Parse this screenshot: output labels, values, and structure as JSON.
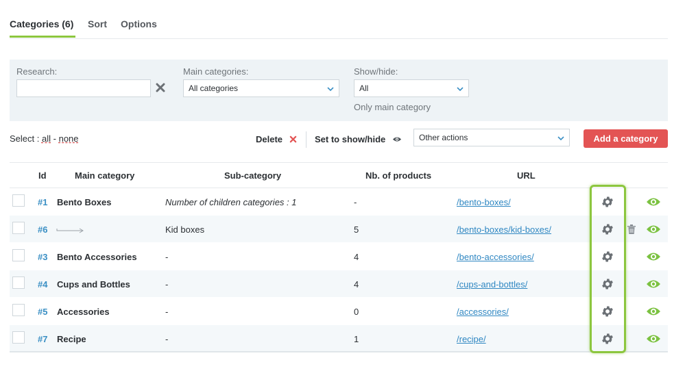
{
  "tabs": [
    {
      "label": "Categories (6)",
      "active": true
    },
    {
      "label": "Sort"
    },
    {
      "label": "Options"
    }
  ],
  "filters": {
    "research_label": "Research:",
    "research_value": "",
    "main_categories_label": "Main categories:",
    "main_categories_value": "All categories",
    "showhide_label": "Show/hide:",
    "showhide_value": "All",
    "only_main_label": "Only main category"
  },
  "toolbar": {
    "select_label": "Select :",
    "select_all": "all",
    "select_sep": "-",
    "select_none": "none",
    "delete_label": "Delete",
    "showhide_label": "Set to show/hide",
    "other_actions": "Other actions",
    "add_label": "Add a category"
  },
  "table": {
    "headers": {
      "id": "Id",
      "main": "Main category",
      "sub": "Sub-category",
      "nb": "Nb. of products",
      "url": "URL"
    },
    "rows": [
      {
        "id": "#1",
        "main": "Bento Boxes",
        "sub": "Number of children categories : 1",
        "nb": "-",
        "url": "/bento-boxes/"
      },
      {
        "id": "#6",
        "main": "",
        "sub": "Kid boxes",
        "nb": "5",
        "url": "/bento-boxes/kid-boxes/"
      },
      {
        "id": "#3",
        "main": "Bento Accessories",
        "sub": "-",
        "nb": "4",
        "url": "/bento-accessories/"
      },
      {
        "id": "#4",
        "main": "Cups and Bottles",
        "sub": "-",
        "nb": "4",
        "url": "/cups-and-bottles/"
      },
      {
        "id": "#5",
        "main": "Accessories",
        "sub": "-",
        "nb": "0",
        "url": "/accessories/"
      },
      {
        "id": "#7",
        "main": "Recipe",
        "sub": "-",
        "nb": "1",
        "url": "/recipe/"
      }
    ]
  },
  "colors": {
    "accent": "#8cc63e",
    "danger": "#e35454",
    "link": "#2f87c2"
  },
  "icons": [
    "clear-x-icon",
    "chevron-down-icon",
    "delete-x-icon",
    "eye-icon",
    "gear-icon",
    "trash-icon",
    "arrow-right-icon"
  ]
}
